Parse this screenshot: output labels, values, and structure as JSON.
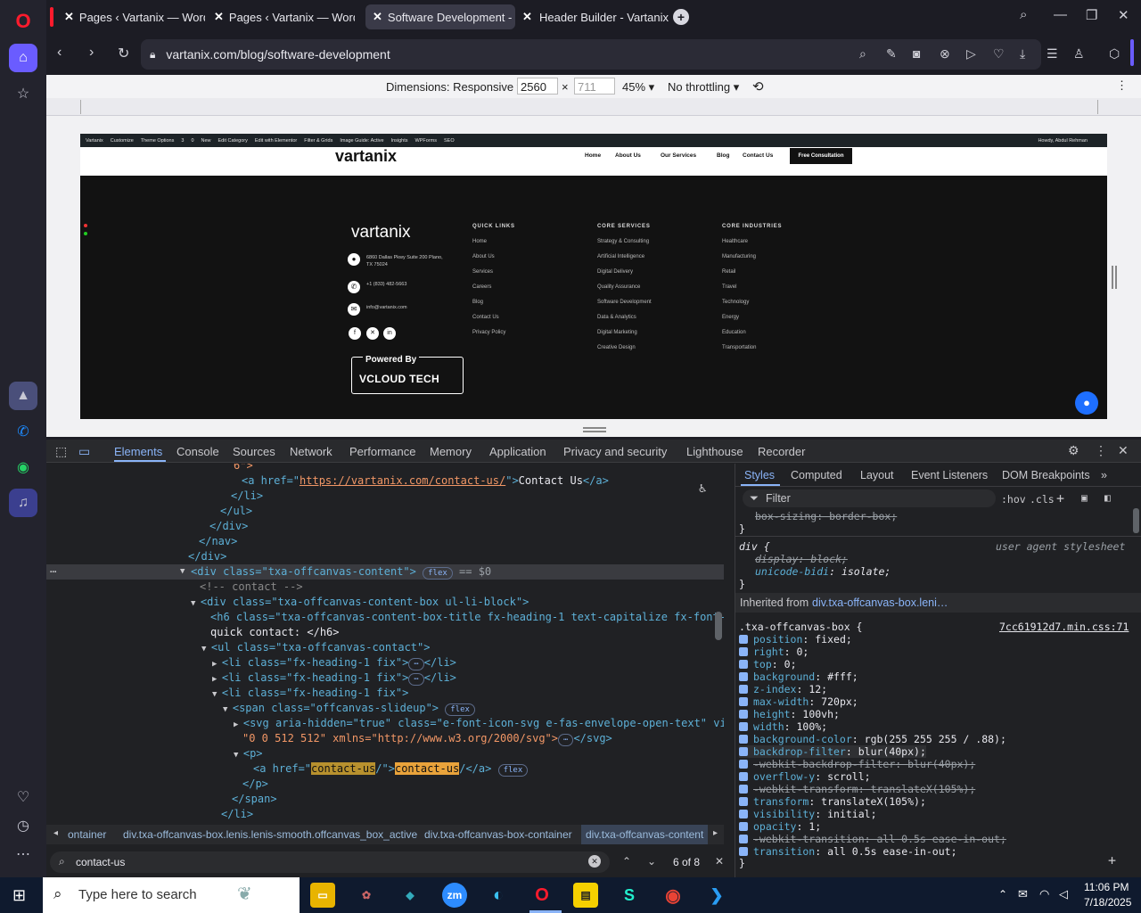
{
  "browser": {
    "tabs": [
      {
        "title": "Pages ‹ Vartanix — WordP",
        "active": false
      },
      {
        "title": "Pages ‹ Vartanix — WordP",
        "active": false
      },
      {
        "title": "Software Development - V",
        "active": true
      },
      {
        "title": "Header Builder - Vartanix",
        "active": false
      }
    ],
    "url": "vartanix.com/blog/software-development"
  },
  "device_toolbar": {
    "dimensions_label": "Dimensions: Responsive",
    "width": "2560",
    "height_placeholder": "711",
    "times": "×",
    "zoom": "45%",
    "throttling": "No throttling"
  },
  "site": {
    "wp_bar": [
      "Vartanix",
      "Customize",
      "Theme Options",
      "3",
      "0",
      "New",
      "Edit Category",
      "Edit with Elementor",
      "Filter & Grids",
      "Image Guide: Active",
      "Insights",
      "WPForms",
      "SEO"
    ],
    "wp_greeting": "Howdy, Abdul Rehman",
    "logo": "vartanix",
    "nav": [
      "Home",
      "About Us",
      "Our Services",
      "Blog",
      "Contact Us"
    ],
    "cta": "Free Consultation",
    "footer": {
      "address": "6860 Dallas Pkwy Suite 200 Plano, TX 75024",
      "phone": "+1 (833) 482-5663",
      "email": "info@vartanix.com",
      "powered_by": "Powered By",
      "powered_brand": "VCLOUD TECH",
      "col1_title": "QUICK LINKS",
      "col1": [
        "Home",
        "About Us",
        "Services",
        "Careers",
        "Blog",
        "Contact Us",
        "Privacy Policy"
      ],
      "col2_title": "CORE SERVICES",
      "col2": [
        "Strategy & Consulting",
        "Artificial Intelligence",
        "Digital Delivery",
        "Quality Assurance",
        "Software Development",
        "Data & Analytics",
        "Digital Marketing",
        "Creative Design"
      ],
      "col3_title": "CORE INDUSTRIES",
      "col3": [
        "Healthcare",
        "Manufacturing",
        "Retail",
        "Travel",
        "Technology",
        "Energy",
        "Education",
        "Transportation"
      ]
    }
  },
  "devtools": {
    "tabs": [
      "Elements",
      "Console",
      "Sources",
      "Network",
      "Performance",
      "Memory",
      "Application",
      "Privacy and security",
      "Lighthouse",
      "Recorder"
    ],
    "dom": {
      "l1": "6\">",
      "l2_pre": "<a href=\"",
      "l2_href": "https://vartanix.com/contact-us/",
      "l2_text": "Contact Us",
      "l3": "</li>",
      "l4": "</ul>",
      "l5": "</div>",
      "l6": "</nav>",
      "l7": "</div>",
      "l8_tag": "<div class=\"txa-offcanvas-content\">",
      "l8_badge": "flex",
      "l8_sel": "== $0",
      "l9": "<!-- contact -->",
      "l10": "<div class=\"txa-offcanvas-content-box  ul-li-block\">",
      "l11": "<h6 class=\"txa-offcanvas-content-box-title fx-heading-1 text-capitalize fx-font-400\">",
      "l12": "quick contact: </h6>",
      "l13": "<ul class=\"txa-offcanvas-contact\">",
      "l14": "<li class=\"fx-heading-1 fix\">",
      "l15": "<li class=\"fx-heading-1 fix\">",
      "l16": "<li class=\"fx-heading-1 fix\">",
      "l17": "<span class=\"offcanvas-slideup\">",
      "l18": "<svg aria-hidden=\"true\" class=\"e-font-icon-svg e-fas-envelope-open-text\" viewBox=",
      "l19": "\"0 0 512 512\" xmlns=\"http://www.w3.org/2000/svg\">",
      "l20": "<p>",
      "l21_pre": "<a href=\"",
      "l21_match1": "contact-us",
      "l21_mid": "/\">",
      "l21_match2": "contact-us",
      "l21_post": "/</a>",
      "l22": "</p>",
      "l23": "</span>",
      "l24": "</li>"
    },
    "crumbs": [
      "ontainer",
      "div.txa-offcanvas-box.lenis.lenis-smooth.offcanvas_box_active",
      "div.txa-offcanvas-box-container",
      "div.txa-offcanvas-content"
    ],
    "search": {
      "query": "contact-us",
      "count": "6 of 8"
    },
    "styles_tabs": [
      "Styles",
      "Computed",
      "Layout",
      "Event Listeners",
      "DOM Breakpoints"
    ],
    "filter_placeholder": "Filter",
    "hov": ":hov",
    "cls": ".cls",
    "ua_label": "user agent stylesheet",
    "inherited_label": "Inherited from",
    "inherited_sel": "div.txa-offcanvas-box.leni…",
    "rule_selector": ".txa-offcanvas-box {",
    "rule_source": "7cc61912d7.min.css:71",
    "props": [
      {
        "name": "position",
        "value": "fixed;",
        "strike": false
      },
      {
        "name": "right",
        "value": "0;",
        "strike": false
      },
      {
        "name": "top",
        "value": "0;",
        "strike": false
      },
      {
        "name": "background",
        "value": "#fff;",
        "strike": false
      },
      {
        "name": "z-index",
        "value": "12;",
        "strike": false
      },
      {
        "name": "max-width",
        "value": "720px;",
        "strike": false
      },
      {
        "name": "height",
        "value": "100vh;",
        "strike": false
      },
      {
        "name": "width",
        "value": "100%;",
        "strike": false
      },
      {
        "name": "background-color",
        "value": "rgb(255 255 255 / .88);",
        "strike": false
      },
      {
        "name": "backdrop-filter",
        "value": "blur(40px);",
        "strike": false
      },
      {
        "name": "-webkit-backdrop-filter",
        "value": "blur(40px);",
        "strike": true
      },
      {
        "name": "overflow-y",
        "value": "scroll;",
        "strike": false
      },
      {
        "name": "-webkit-transform",
        "value": "translateX(105%);",
        "strike": true
      },
      {
        "name": "transform",
        "value": "translateX(105%);",
        "strike": false
      },
      {
        "name": "visibility",
        "value": "initial;",
        "strike": false
      },
      {
        "name": "opacity",
        "value": "1;",
        "strike": false
      },
      {
        "name": "-webkit-transition",
        "value": "all 0.5s ease-in-out;",
        "strike": true
      },
      {
        "name": "transition",
        "value": "all 0.5s ease-in-out;",
        "strike": false
      }
    ]
  },
  "taskbar": {
    "search_placeholder": "Type here to search",
    "time": "11:06 PM",
    "date": "7/18/2025"
  }
}
